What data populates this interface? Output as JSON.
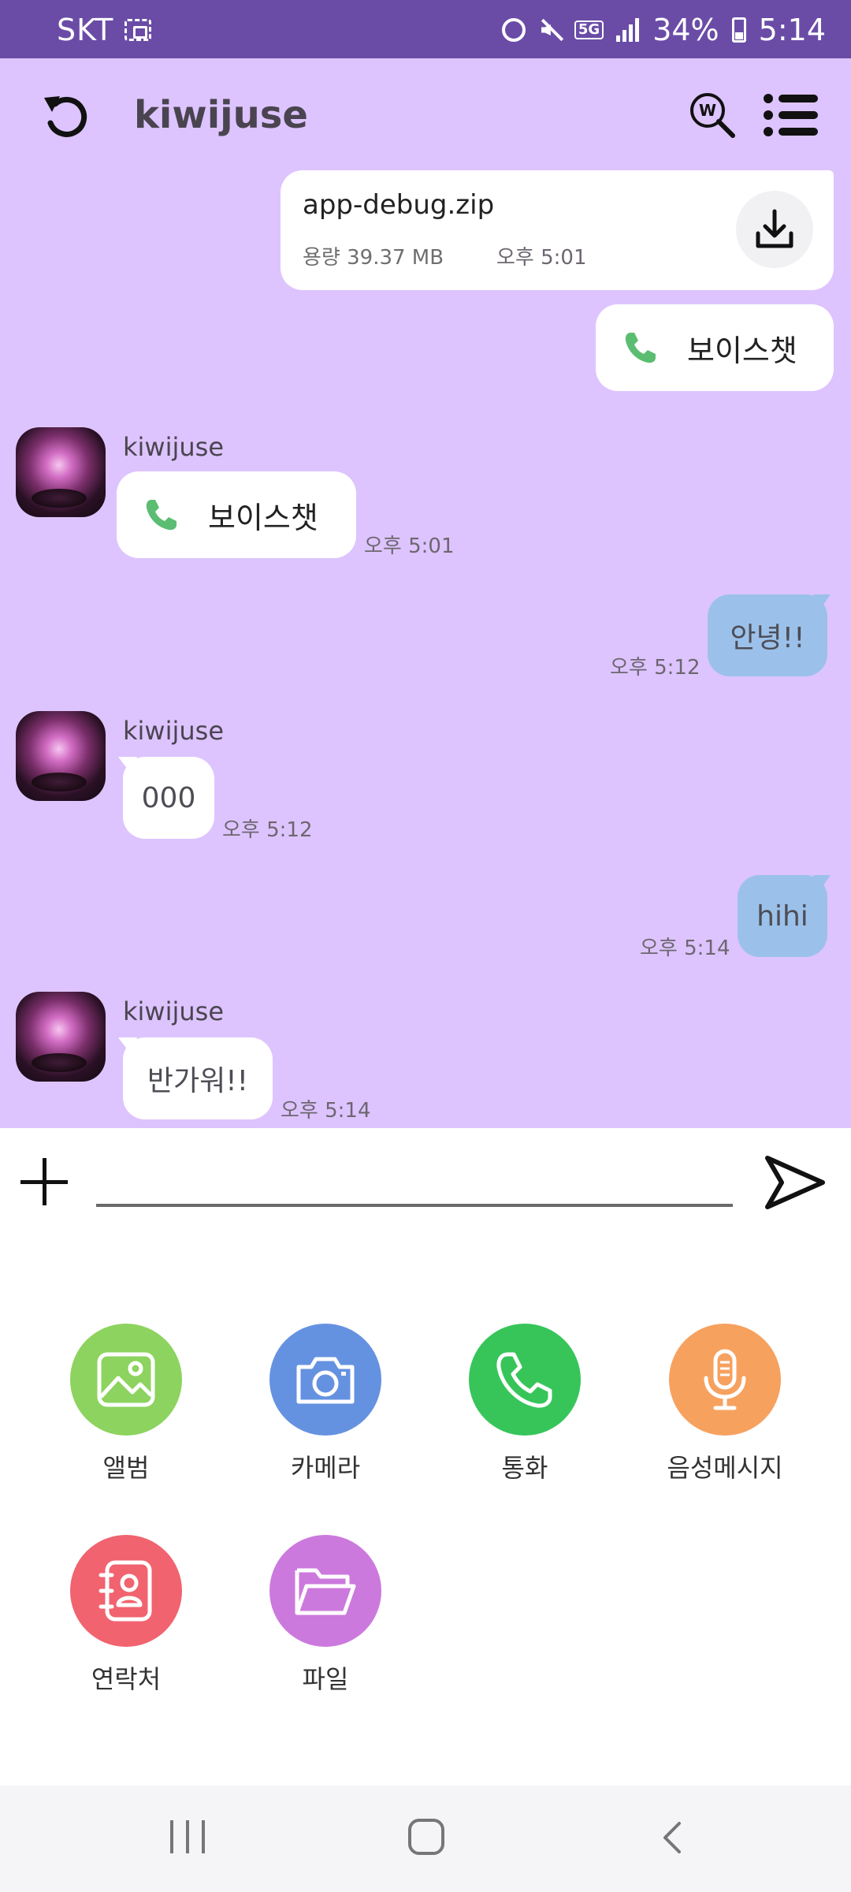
{
  "status_bar": {
    "carrier": "SKT",
    "network": "5G",
    "battery": "34%",
    "time": "5:14"
  },
  "header": {
    "title": "kiwijuse"
  },
  "messages": {
    "file": {
      "name": "app-debug.zip",
      "size": "용량 39.37 MB"
    },
    "m1": {
      "label": "보이스챗",
      "time": "오후 5:01"
    },
    "m2": {
      "sender": "kiwijuse",
      "label": "보이스챗",
      "time": "오후 5:01"
    },
    "m3": {
      "text": "안녕!!",
      "time": "오후 5:12"
    },
    "m4": {
      "sender": "kiwijuse",
      "text": "000",
      "time": "오후 5:12"
    },
    "m5": {
      "text": "hihi",
      "time": "오후 5:14"
    },
    "m6": {
      "sender": "kiwijuse",
      "text": "반가워!!",
      "time": "오후 5:14"
    }
  },
  "input": {
    "placeholder": "",
    "value": ""
  },
  "attachments": {
    "album": {
      "label": "앨범",
      "color": "#8dd35f",
      "icon": "image-icon"
    },
    "camera": {
      "label": "카메라",
      "color": "#6592e0",
      "icon": "camera-icon"
    },
    "call": {
      "label": "통화",
      "color": "#37c55a",
      "icon": "phone-icon"
    },
    "voice_message": {
      "label": "음성메시지",
      "color": "#f7a15f",
      "icon": "microphone-icon"
    },
    "contacts": {
      "label": "연락처",
      "color": "#f0636f",
      "icon": "contact-book-icon"
    },
    "file": {
      "label": "파일",
      "color": "#cc79dd",
      "icon": "folder-icon"
    }
  },
  "colors": {
    "status_bar": "#6a4ca7",
    "chat_background": "#ddc4fe",
    "my_bubble": "#9bc1ea",
    "their_bubble": "#ffffff"
  }
}
